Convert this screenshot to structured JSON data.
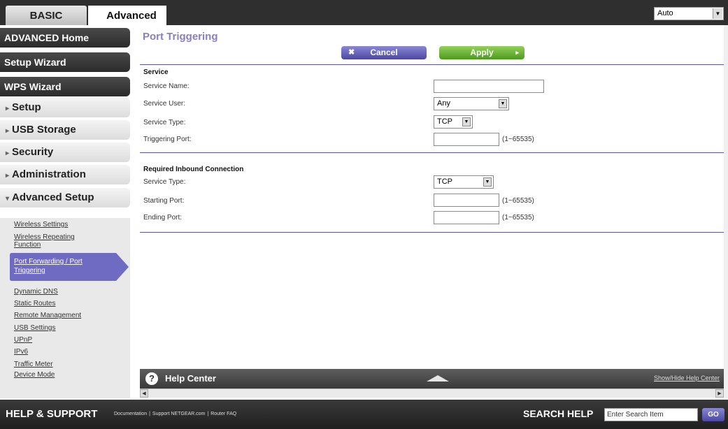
{
  "tabs": {
    "basic": "BASIC",
    "advanced": "Advanced"
  },
  "language": {
    "selected": "Auto"
  },
  "sidebar": {
    "advanced_home": "ADVANCED Home",
    "setup_wizard": "Setup Wizard",
    "wps_wizard": "WPS Wizard",
    "setup": "Setup",
    "usb_storage": "USB Storage",
    "security": "Security",
    "administration": "Administration",
    "advanced_setup": "Advanced Setup",
    "sub_items": [
      "Wireless Settings",
      "Wireless Repeating",
      "Function",
      "Port Forwarding / Port",
      "Triggering",
      "Dynamic DNS",
      "Static Routes",
      "Remote Management",
      "USB Settings",
      "UPnP",
      "IPv6",
      "Traffic Meter",
      "Device Mode"
    ]
  },
  "page": {
    "title": "Port Triggering",
    "cancel": "Cancel",
    "apply": "Apply"
  },
  "service": {
    "heading": "Service",
    "name_label": "Service Name:",
    "name_value": "",
    "user_label": "Service User:",
    "user_value": "Any",
    "type_label": "Service Type:",
    "type_value": "TCP",
    "trigger_label": "Triggering Port:",
    "trigger_value": "",
    "range_hint": "(1~65535)"
  },
  "inbound": {
    "heading": "Required Inbound Connection",
    "type_label": "Service Type:",
    "type_value": "TCP",
    "start_label": "Starting Port:",
    "start_value": "",
    "end_label": "Ending Port:",
    "end_value": "",
    "range_hint": "(1~65535)"
  },
  "help": {
    "title": "Help Center",
    "toggle": "Show/Hide Help Center"
  },
  "footer": {
    "title": "HELP & SUPPORT",
    "links": [
      "Documentation",
      "Support NETGEAR.com",
      "Router FAQ"
    ],
    "search_label": "SEARCH HELP",
    "search_placeholder": "Enter Search Item",
    "go": "GO"
  }
}
